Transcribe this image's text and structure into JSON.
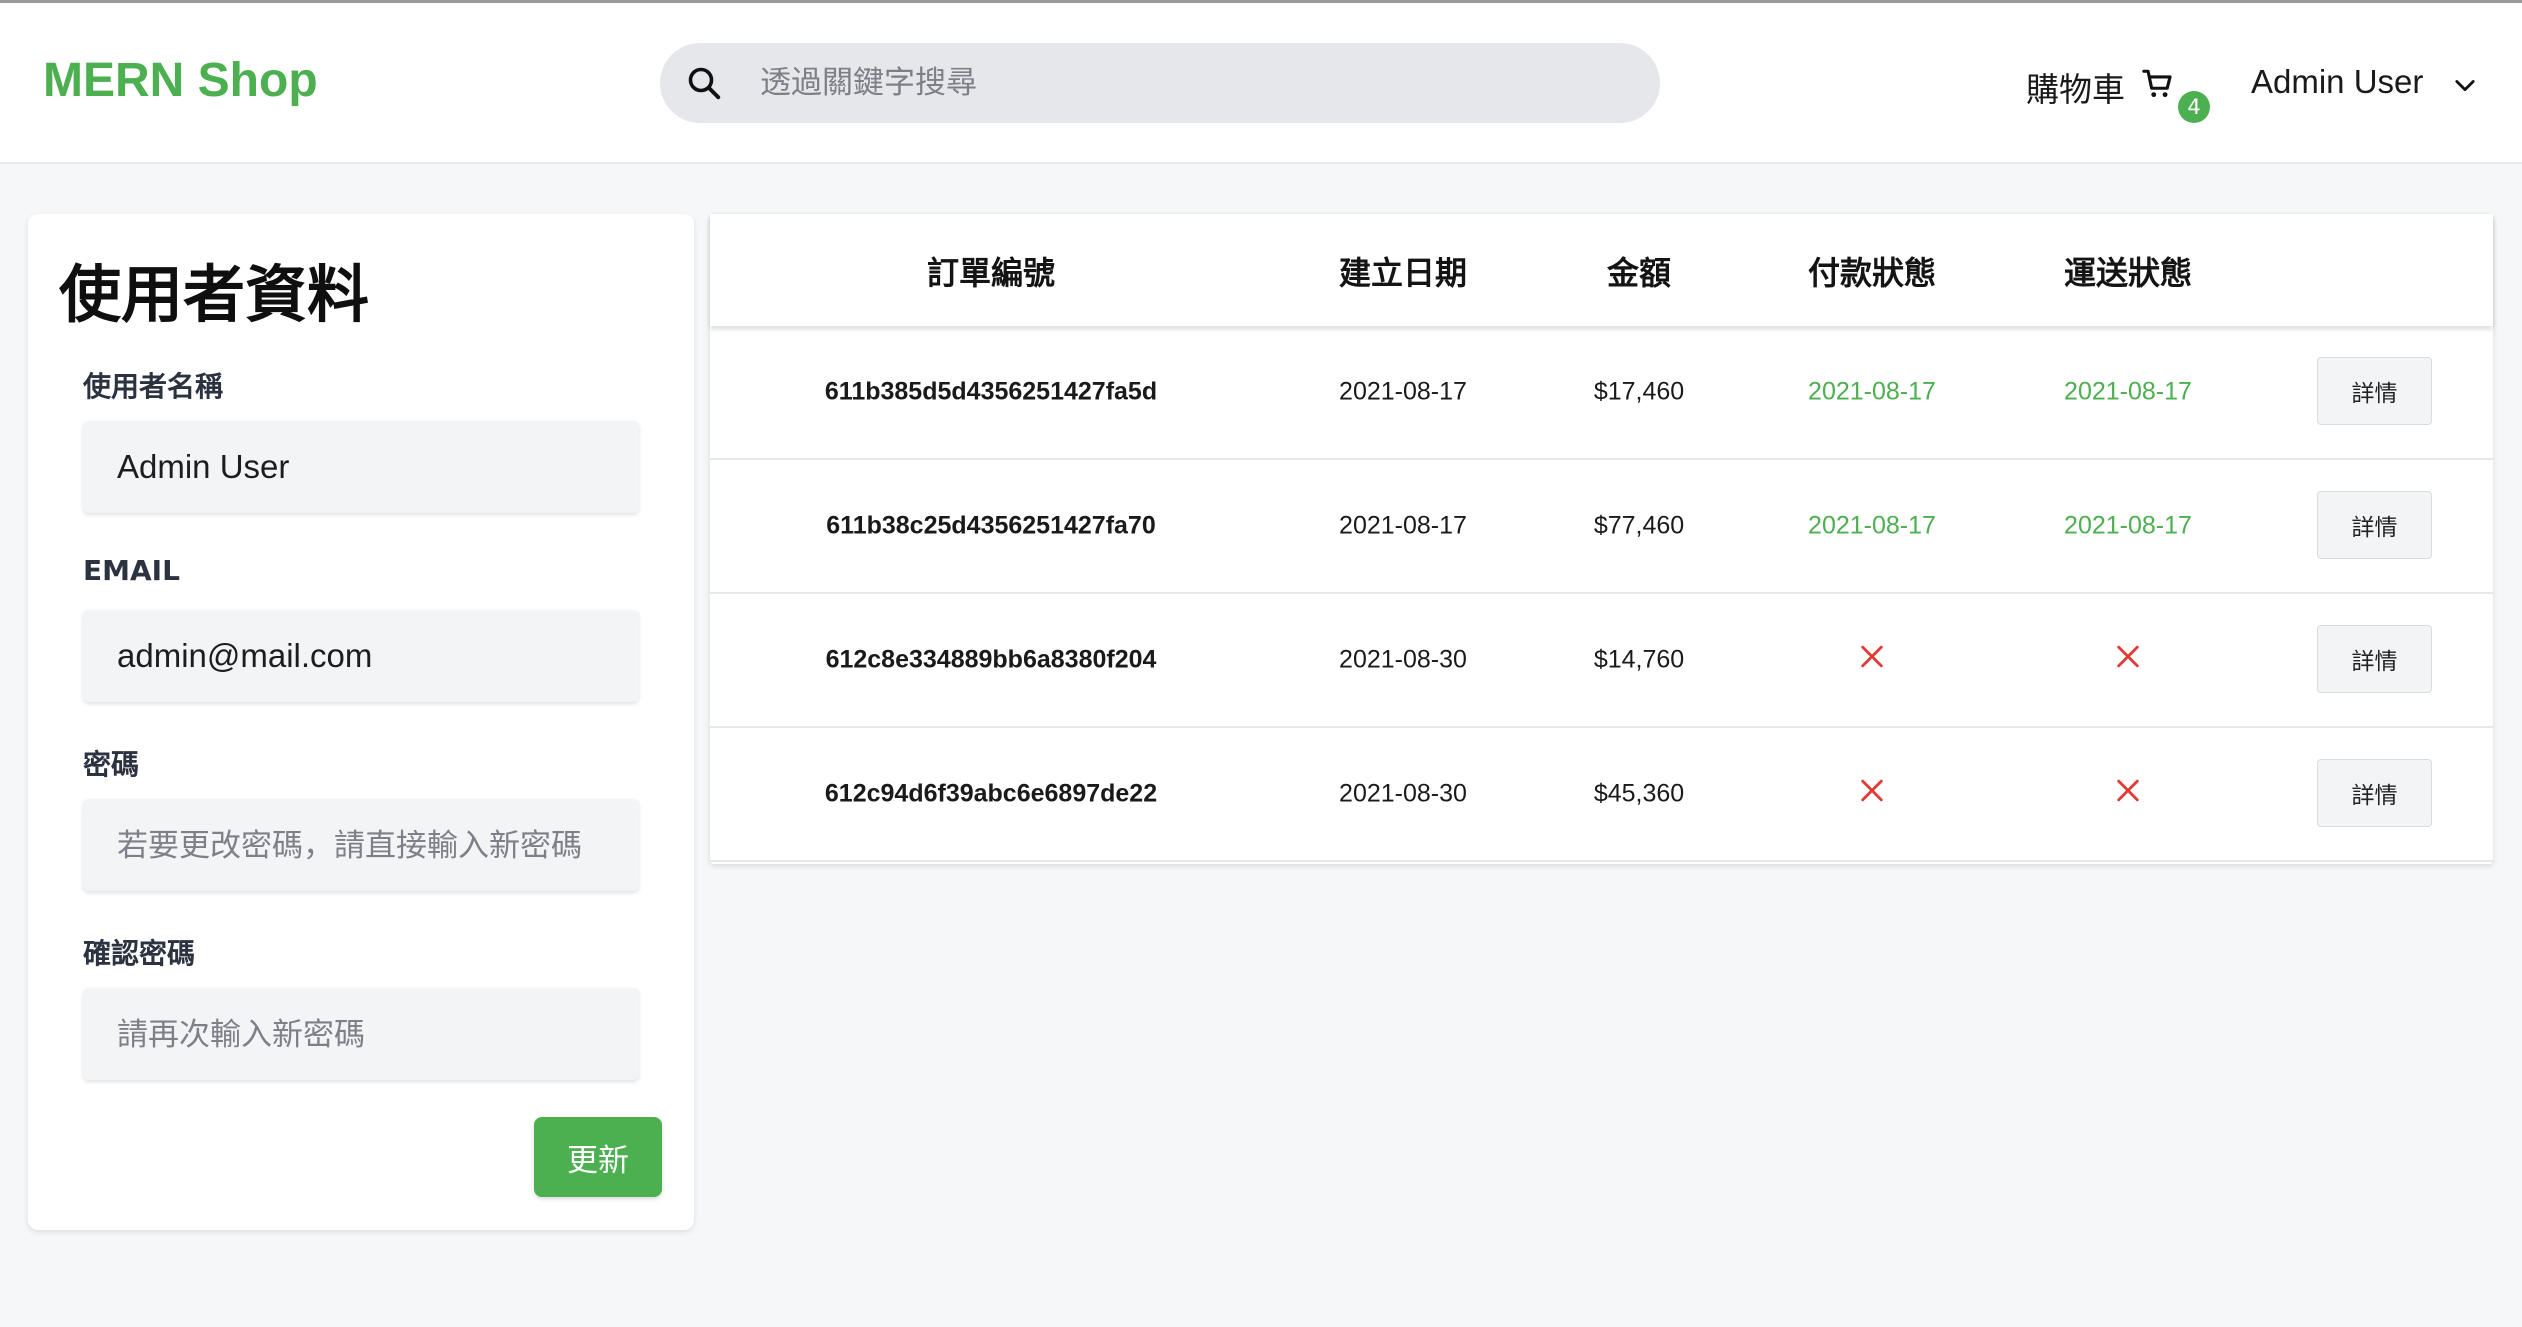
{
  "header": {
    "logo": "MERN Shop",
    "search_placeholder": "透過關鍵字搜尋",
    "cart_label": "購物車",
    "cart_count": "4",
    "user_name": "Admin User"
  },
  "profile": {
    "title": "使用者資料",
    "name_label": "使用者名稱",
    "name_value": "Admin User",
    "email_label": "EMAIL",
    "email_value": "admin@mail.com",
    "password_label": "密碼",
    "password_placeholder": "若要更改密碼，請直接輸入新密碼",
    "confirm_label": "確認密碼",
    "confirm_placeholder": "請再次輸入新密碼",
    "update_button": "更新"
  },
  "orders": {
    "headers": [
      "訂單編號",
      "建立日期",
      "金額",
      "付款狀態",
      "運送狀態"
    ],
    "rows": [
      {
        "id": "611b385d5d4356251427fa5d",
        "date": "2021-08-17",
        "amount": "$17,460",
        "paid": "2021-08-17",
        "delivered": "2021-08-17",
        "button": "詳情"
      },
      {
        "id": "611b38c25d4356251427fa70",
        "date": "2021-08-17",
        "amount": "$77,460",
        "paid": "2021-08-17",
        "delivered": "2021-08-17",
        "button": "詳情"
      },
      {
        "id": "612c8e334889bb6a8380f204",
        "date": "2021-08-30",
        "amount": "$14,760",
        "paid": null,
        "delivered": null,
        "button": "詳情"
      },
      {
        "id": "612c94d6f39abc6e6897de22",
        "date": "2021-08-30",
        "amount": "$45,360",
        "paid": null,
        "delivered": null,
        "button": "詳情"
      }
    ]
  },
  "colors": {
    "accent": "#4caf50",
    "cross": "#e53935"
  },
  "icons": {
    "search": "search-icon",
    "cart": "cart-icon",
    "chevron": "chevron-down-icon",
    "not_paid": "x-icon"
  }
}
